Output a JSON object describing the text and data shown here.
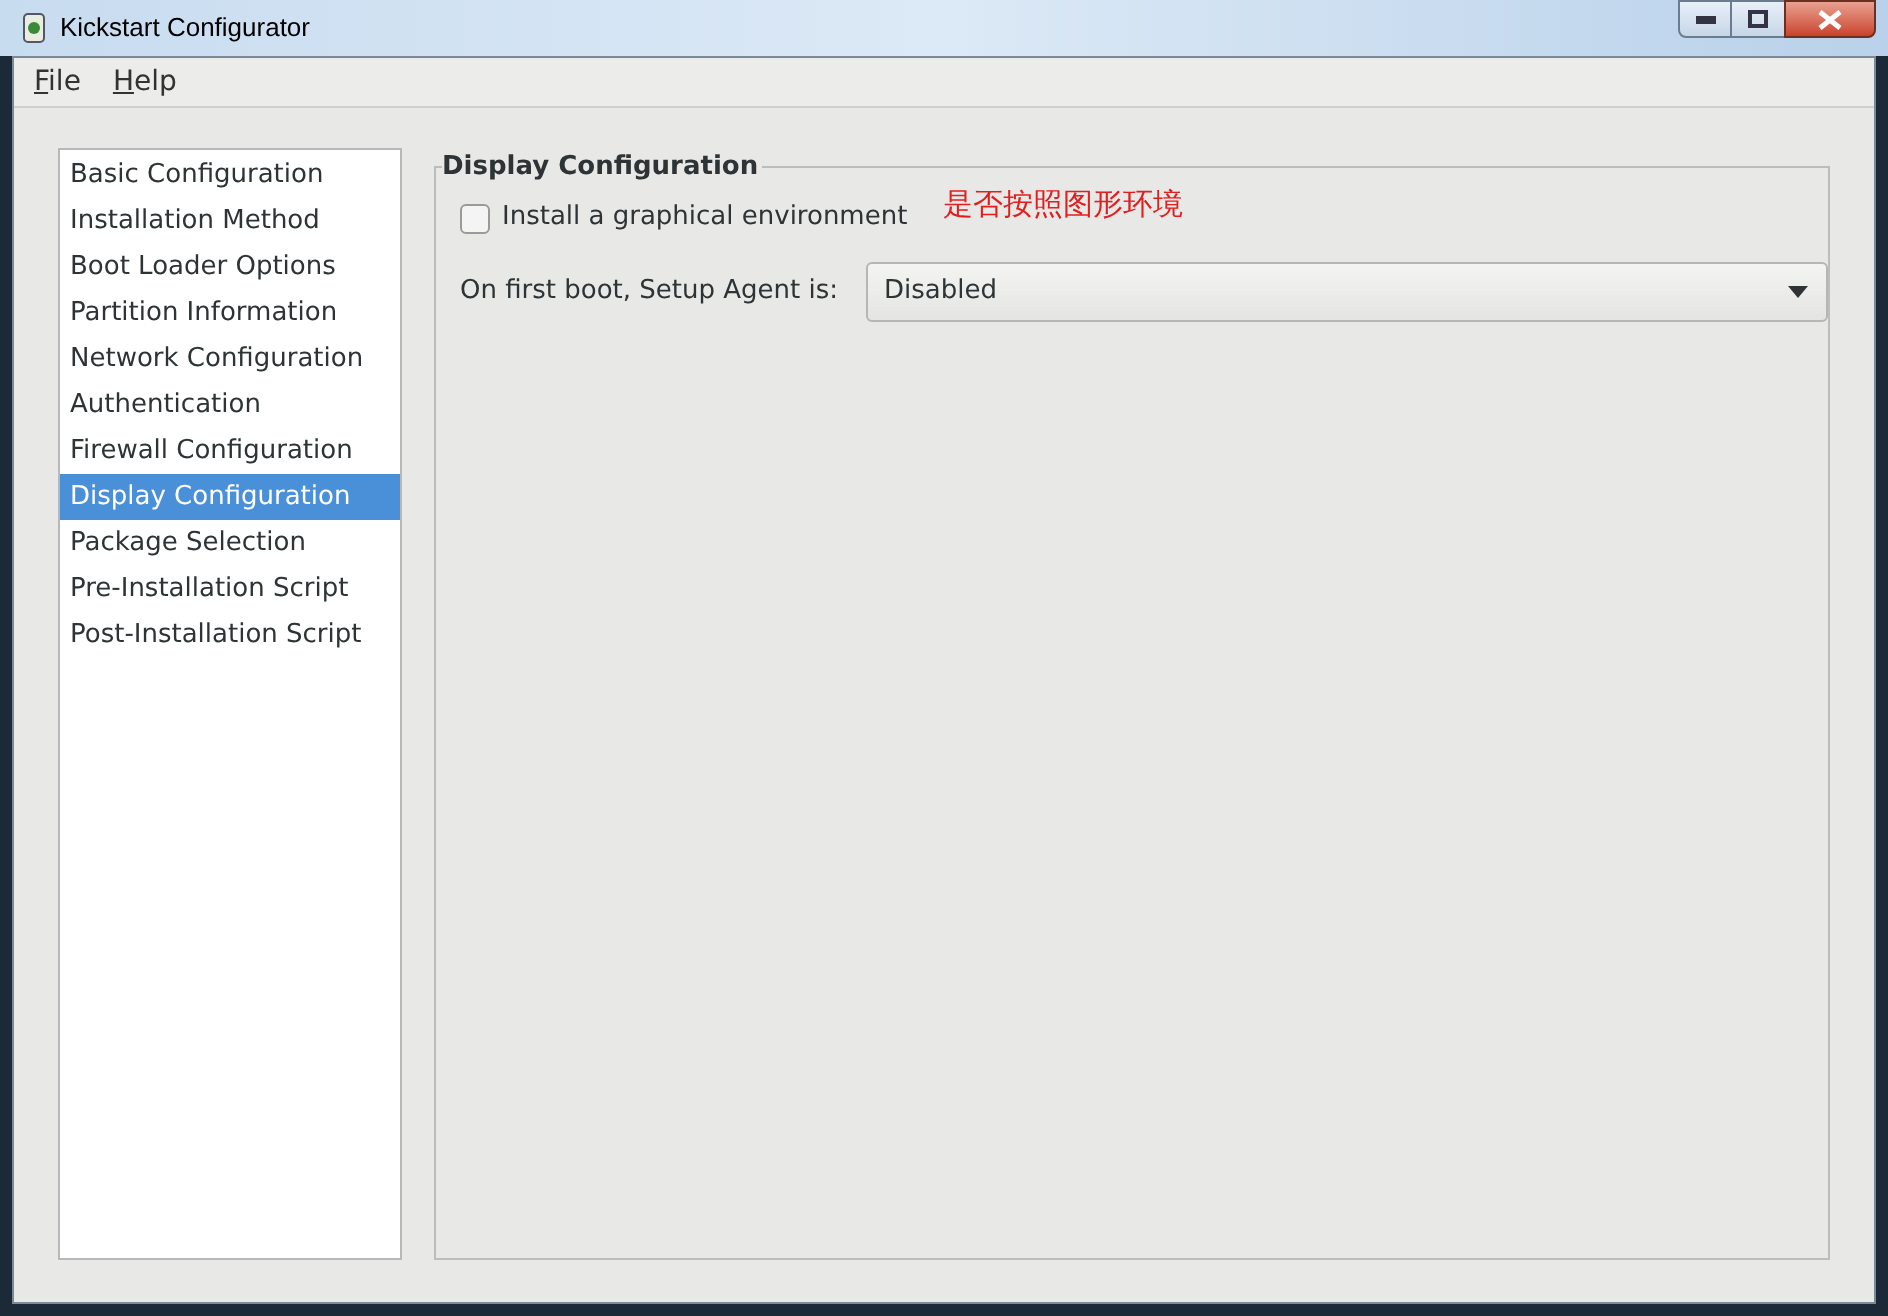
{
  "window": {
    "title": "Kickstart Configurator"
  },
  "menu": [
    {
      "label": "File"
    },
    {
      "label": "Help"
    }
  ],
  "sidebar": {
    "items": [
      {
        "label": "Basic Configuration",
        "selected": false
      },
      {
        "label": "Installation Method",
        "selected": false
      },
      {
        "label": "Boot Loader Options",
        "selected": false
      },
      {
        "label": "Partition Information",
        "selected": false
      },
      {
        "label": "Network Configuration",
        "selected": false
      },
      {
        "label": "Authentication",
        "selected": false
      },
      {
        "label": "Firewall Configuration",
        "selected": false
      },
      {
        "label": "Display Configuration",
        "selected": true
      },
      {
        "label": "Package Selection",
        "selected": false
      },
      {
        "label": "Pre-Installation Script",
        "selected": false
      },
      {
        "label": "Post-Installation Script",
        "selected": false
      }
    ]
  },
  "panel": {
    "title": "Display Configuration",
    "checkbox": {
      "label": "Install a graphical environment",
      "checked": false
    },
    "annotation": "是否按照图形环境",
    "setup_agent": {
      "label": "On first boot, Setup Agent is:",
      "value": "Disabled"
    }
  }
}
